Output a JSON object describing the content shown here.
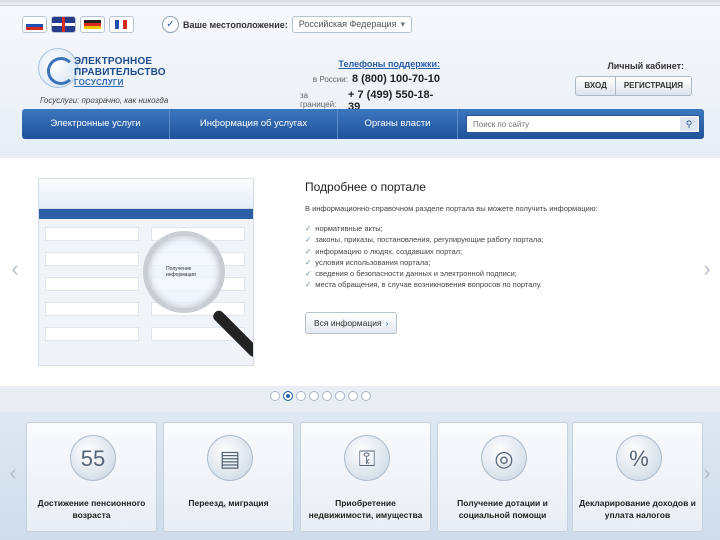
{
  "header": {
    "languages": [
      {
        "name": "russian-flag"
      },
      {
        "name": "uk-flag"
      },
      {
        "name": "german-flag"
      },
      {
        "name": "french-flag"
      }
    ],
    "location_label": "Ваше местоположение:",
    "location_value": "Российская Федерация",
    "brand_line1": "ЭЛЕКТРОННОЕ",
    "brand_line2": "ПРАВИТЕЛЬСТВО",
    "brand_line3": "ГОСУСЛУГИ",
    "tagline": "Госуслуги: прозрачно, как никогда",
    "support_title": "Телефоны поддержки:",
    "phones": [
      {
        "label": "в России:",
        "number": "8 (800) 100-70-10"
      },
      {
        "label": "за границей:",
        "number": "+ 7 (499) 550-18-39"
      }
    ],
    "cabinet_title": "Личный кабинет:",
    "login_label": "ВХОД",
    "register_label": "РЕГИСТРАЦИЯ"
  },
  "nav": {
    "items": [
      "Электронные услуги",
      "Информация об услугах",
      "Органы власти"
    ],
    "search_placeholder": "Поиск по сайту"
  },
  "slider": {
    "title": "Подробнее о портале",
    "intro": "В информационно-справочном разделе портала вы можете получить информацию:",
    "items": [
      "нормативные акты;",
      "законы, приказы, постановления, регулирующие работу портала;",
      "информацию о людях, создавших портал;",
      "условия использования портала;",
      "сведения о безопасности данных и электронной подписи;",
      "места обращения, в случае возникновения вопросов по порталу."
    ],
    "more_label": "Вся информация",
    "lens_text": "Получение информации",
    "dots_total": 8,
    "active_dot": 2
  },
  "cards": [
    {
      "label": "Достижение пенсионного возраста",
      "icon": "calendar-icon",
      "glyph": "55"
    },
    {
      "label": "Переезд, миграция",
      "icon": "passport-icon",
      "glyph": "▤"
    },
    {
      "label": "Приобретение недвижимости, имущества",
      "icon": "keys-icon",
      "glyph": "⚿"
    },
    {
      "label": "Получение дотации и социальной помощи",
      "icon": "lifebuoy-icon",
      "glyph": "◎"
    },
    {
      "label": "Декларирование доходов и уплата налогов",
      "icon": "percent-icon",
      "glyph": "%"
    }
  ],
  "colors": {
    "nav_blue": "#2a5fa6",
    "brand_blue": "#1e4c8c",
    "page_bg": "#e8eef4"
  }
}
